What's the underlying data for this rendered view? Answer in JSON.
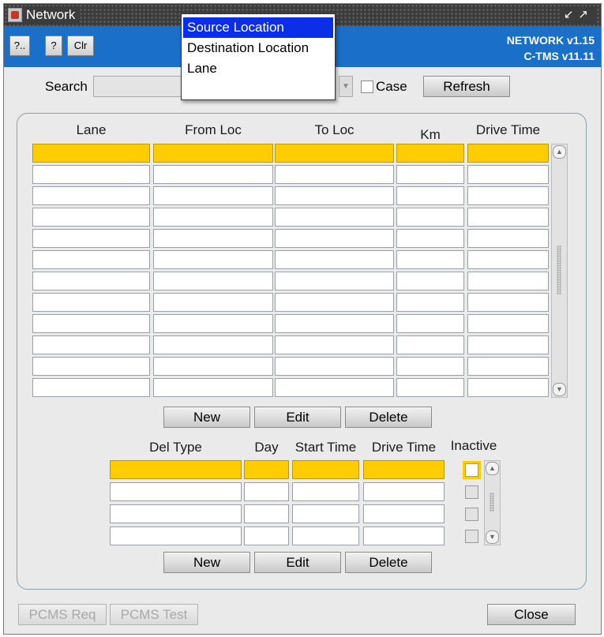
{
  "window": {
    "title": "Network",
    "controls": "↙↗"
  },
  "toolbar": {
    "btn_help_more": "?..",
    "btn_help": "?",
    "btn_clear": "Clr",
    "version_network": "NETWORK v1.15",
    "version_tms": "C-TMS v11.11"
  },
  "search": {
    "label": "Search",
    "value": "",
    "case_label": "Case",
    "case_checked": false,
    "refresh_label": "Refresh",
    "dropdown_options": [
      "Source Location",
      "Destination Location",
      "Lane"
    ],
    "dropdown_selected": "Source Location"
  },
  "lanes": {
    "headers": [
      "Lane",
      "From Loc",
      "To Loc",
      "Km",
      "Drive Time"
    ],
    "rows": [
      [
        "",
        "",
        "",
        "",
        ""
      ],
      [
        "",
        "",
        "",
        "",
        ""
      ],
      [
        "",
        "",
        "",
        "",
        ""
      ],
      [
        "",
        "",
        "",
        "",
        ""
      ],
      [
        "",
        "",
        "",
        "",
        ""
      ],
      [
        "",
        "",
        "",
        "",
        ""
      ],
      [
        "",
        "",
        "",
        "",
        ""
      ],
      [
        "",
        "",
        "",
        "",
        ""
      ],
      [
        "",
        "",
        "",
        "",
        ""
      ],
      [
        "",
        "",
        "",
        "",
        ""
      ],
      [
        "",
        "",
        "",
        "",
        ""
      ],
      [
        "",
        "",
        "",
        "",
        ""
      ]
    ],
    "selected_row": 0,
    "new_label": "New",
    "edit_label": "Edit",
    "delete_label": "Delete"
  },
  "deliveries": {
    "headers": [
      "Del Type",
      "Day",
      "Start Time",
      "Drive Time",
      "Inactive"
    ],
    "rows": [
      [
        "",
        "",
        "",
        "",
        false
      ],
      [
        "",
        "",
        "",
        "",
        false
      ],
      [
        "",
        "",
        "",
        "",
        false
      ],
      [
        "",
        "",
        "",
        "",
        false
      ]
    ],
    "selected_row": 0,
    "new_label": "New",
    "edit_label": "Edit",
    "delete_label": "Delete"
  },
  "footer": {
    "pcms_req_label": "PCMS Req",
    "pcms_test_label": "PCMS Test",
    "close_label": "Close"
  },
  "colors": {
    "toolbar_blue": "#1a6fc8",
    "selected_row": "#ffcc00",
    "dropdown_highlight": "#0b2ee8"
  }
}
